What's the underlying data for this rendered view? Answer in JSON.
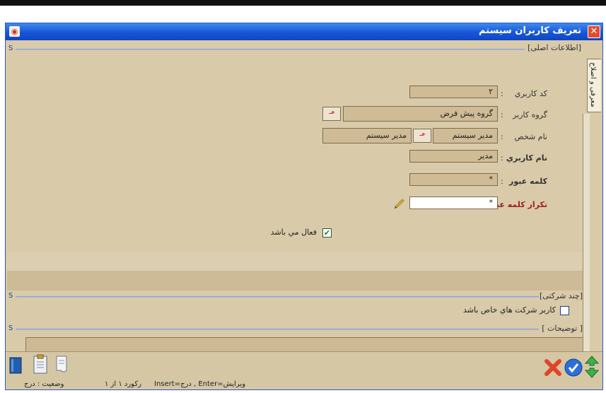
{
  "window": {
    "title": "تعريف كاربران سيستم",
    "close_glyph": "✕",
    "app_icon_glyph": "◉"
  },
  "side_tab": {
    "label": "معرفی و اصلاح"
  },
  "sections": {
    "main_info": {
      "title": "[اطلاعات اصلی]",
      "marker": "S"
    },
    "multi_company": {
      "title": "[چند شرکتی]",
      "marker": "S"
    },
    "notes": {
      "title": "[ توضیحات ]",
      "marker": "S"
    }
  },
  "form": {
    "user_code": {
      "label": "کد کاربري",
      "colon": ":",
      "value": "۲"
    },
    "user_group": {
      "label": "گروه کاربر",
      "colon": ":",
      "value": "گروه پیش فرض"
    },
    "person_name": {
      "label": "نام شخص",
      "colon": ":",
      "value": "مدير سيستم",
      "value2": "مدیر سیستم"
    },
    "username": {
      "label": "نام کاربري",
      "colon": ":",
      "value": "مدير"
    },
    "password": {
      "label": "کلمه عبور",
      "colon": ":",
      "value": "*"
    },
    "password_repeat": {
      "label": "تکرار کلمه عبور",
      "colon": ":",
      "value": "*"
    },
    "active": {
      "label": "فعال مي باشد",
      "checked": true
    },
    "specific_companies": {
      "label": "کاربر شرکت هاي خاص باشد",
      "checked": false
    }
  },
  "statusbar": {
    "status": "وضعیت : درج",
    "record": "رکورد ۱ از ۱",
    "hint": "Insert=درج , Enter=ویرایش"
  },
  "colors": {
    "title_bar": "#1856d6",
    "panel": "#d9caa9",
    "accent_red": "#c0392b"
  }
}
